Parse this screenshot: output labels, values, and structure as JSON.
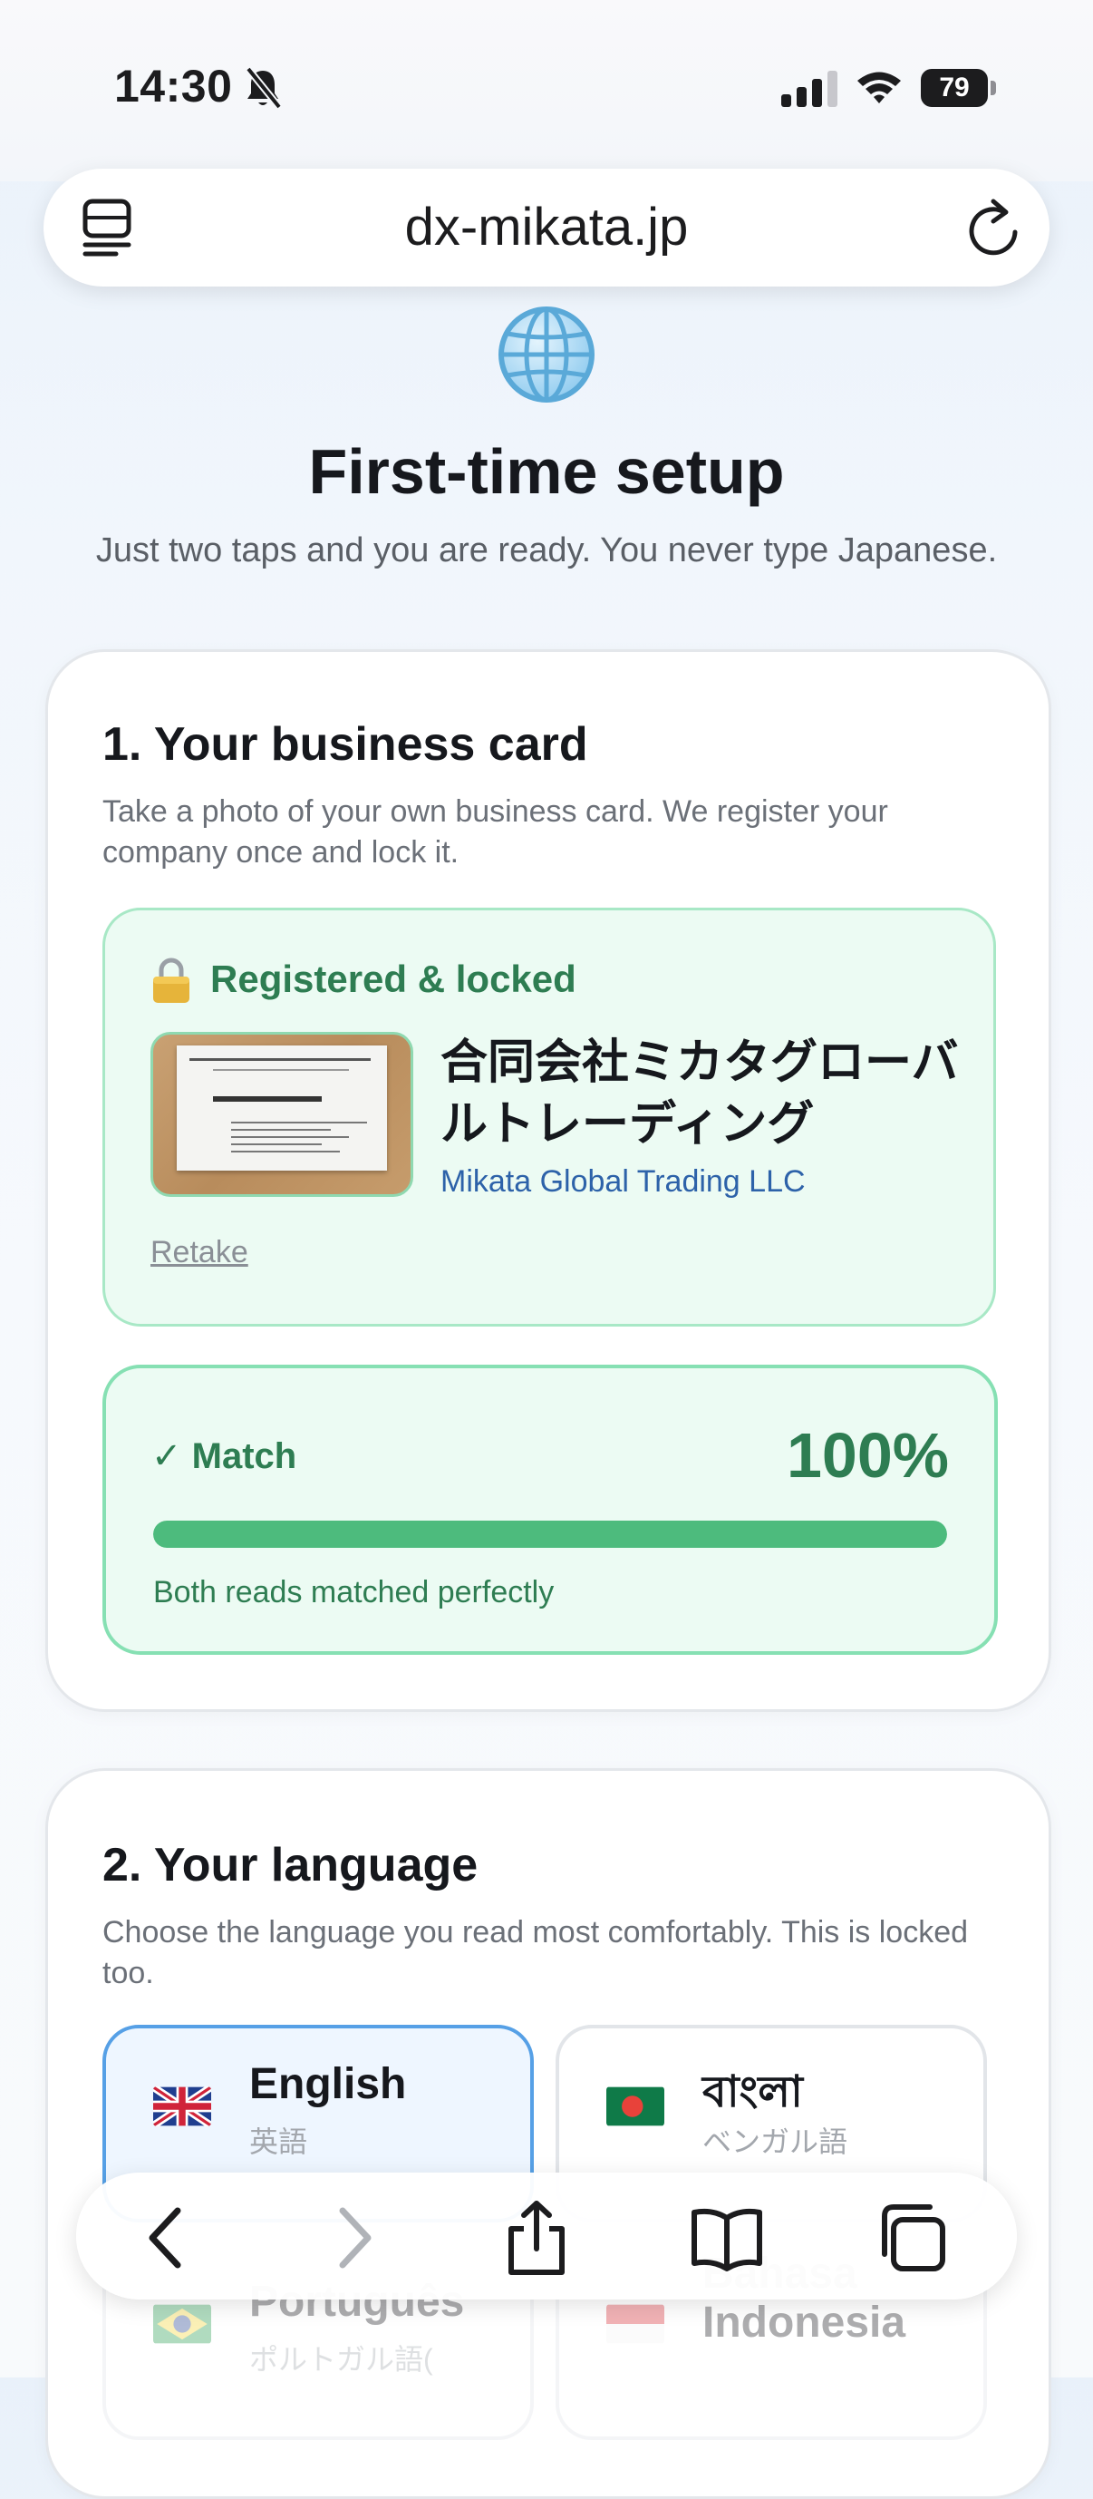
{
  "status_bar": {
    "time": "14:30",
    "battery": "79"
  },
  "browser": {
    "url": "dx-mikata.jp"
  },
  "header": {
    "title": "First-time setup",
    "subtitle": "Just two taps and you are ready. You never type Japanese."
  },
  "business_card": {
    "title": "1. Your business card",
    "description": "Take a photo of your own business card. We register your company once and lock it.",
    "registered_label": "Registered & locked",
    "company_name_ja": "合同会社ミカタグローバルトレーディング",
    "company_name_en": "Mikata Global Trading LLC",
    "retake_label": "Retake",
    "match": {
      "label": "✓ Match",
      "percent_text": "100%",
      "percent": 100,
      "note": "Both reads matched perfectly"
    }
  },
  "language": {
    "title": "2. Your language",
    "description": "Choose the language you read most comfortably. This is locked too.",
    "options": [
      {
        "name": "English",
        "local": "英語",
        "selected": true
      },
      {
        "name": "বাংলা",
        "local": "ベンガル語",
        "selected": false
      },
      {
        "name": "Português",
        "local": "ポルトガル語(",
        "selected": false
      },
      {
        "name": "Bahasa Indonesia",
        "local": "",
        "selected": false
      }
    ]
  },
  "colors": {
    "success": "#2e7d52",
    "progress": "#4dbb7d",
    "selected_border": "#56a0e6",
    "link": "#2d62a9"
  }
}
